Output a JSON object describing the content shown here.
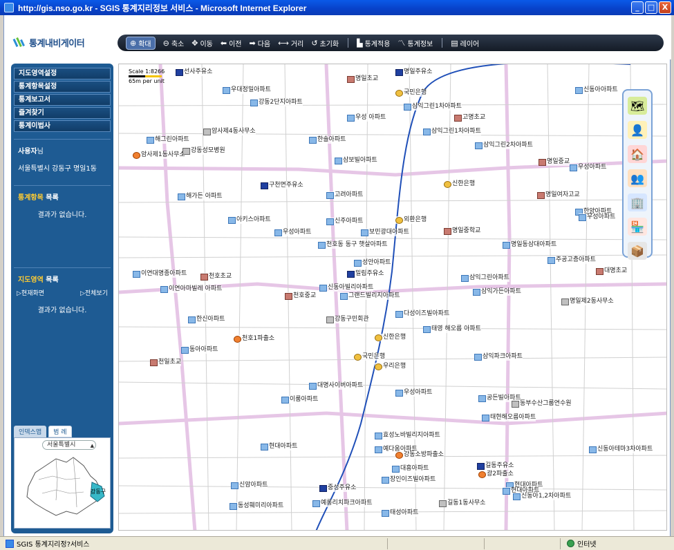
{
  "window": {
    "title": "http://gis.nso.go.kr - SGIS 통계지리정보 서비스 - Microsoft Internet Explorer",
    "buttons": [
      "_",
      "□",
      "X"
    ]
  },
  "header": {
    "logo_text": "통계내비게이터",
    "toolbar": [
      {
        "id": "zoom-in",
        "icon": "zoom-in-icon",
        "glyph": "⊕",
        "label": "확대",
        "active": true
      },
      {
        "id": "zoom-out",
        "icon": "zoom-out-icon",
        "glyph": "⊖",
        "label": "축소"
      },
      {
        "id": "pan",
        "icon": "move-icon",
        "glyph": "✥",
        "label": "이동"
      },
      {
        "id": "prev",
        "icon": "arrow-left-icon",
        "glyph": "⬅",
        "label": "이전"
      },
      {
        "id": "next",
        "icon": "arrow-right-icon",
        "glyph": "➡",
        "label": "다음"
      },
      {
        "id": "distance",
        "icon": "ruler-icon",
        "glyph": "⟷",
        "label": "거리"
      },
      {
        "id": "reset",
        "icon": "reset-icon",
        "glyph": "↺",
        "label": "초기화"
      },
      {
        "id": "apply-stats",
        "icon": "bar-chart-icon",
        "glyph": "▙",
        "label": "통계적용"
      },
      {
        "id": "stats-info",
        "icon": "line-chart-icon",
        "glyph": "〽",
        "label": "통계정보"
      },
      {
        "id": "layer",
        "icon": "layer-icon",
        "glyph": "▤",
        "label": "레이어"
      }
    ]
  },
  "sidebar": {
    "menu": [
      "지도영역설정",
      "통계항목설정",
      "통계보고서",
      "즐겨찾기",
      "통계이법사"
    ],
    "user_label": "사용자",
    "user_suffix": "님",
    "address": "서울특별시 강동구 명일1동",
    "stat_items_title": "통계항목",
    "stat_items_suffix": " 목록",
    "no_result": "결과가 없습니다.",
    "region_title": "지도영역",
    "region_suffix": " 목록",
    "region_current": "▷현재화면",
    "region_all": "▷전체보기",
    "no_result_2": "결과가 없습니다.",
    "mini_tabs": [
      "인덱스맵",
      "범 례"
    ],
    "mini_select": "서울특별시",
    "mini_highlight": "강동구"
  },
  "map": {
    "scale_text": "Scale 1:8266",
    "scale_unit": "65m per unit",
    "labels": [
      {
        "t": "선사주유소",
        "c": "gas"
      },
      {
        "t": "명일초교",
        "c": "school"
      },
      {
        "t": "명일주유소",
        "c": "gas"
      },
      {
        "t": "우대정밀아파트",
        "c": ""
      },
      {
        "t": "강동2단지아파트",
        "c": ""
      },
      {
        "t": "국민은행",
        "c": "bank"
      },
      {
        "t": "삼익그린1차아파트",
        "c": ""
      },
      {
        "t": "신동아아파트",
        "c": ""
      },
      {
        "t": "우성 아파트",
        "c": ""
      },
      {
        "t": "고명초교",
        "c": "school"
      },
      {
        "t": "삼익그린1차아파트",
        "c": ""
      },
      {
        "t": "암사제4동사무소",
        "c": "gov"
      },
      {
        "t": "한솔아파트",
        "c": ""
      },
      {
        "t": "삼익그린2차아파트",
        "c": ""
      },
      {
        "t": "해그린아파트",
        "c": ""
      },
      {
        "t": "암사제1동사무소",
        "c": "fire"
      },
      {
        "t": "강동성모병원",
        "c": "gov"
      },
      {
        "t": "삼보빌아파트",
        "c": ""
      },
      {
        "t": "명일중교",
        "c": "school"
      },
      {
        "t": "우성아파트",
        "c": ""
      },
      {
        "t": "구천면주유소",
        "c": "gas"
      },
      {
        "t": "신한은행",
        "c": "bank"
      },
      {
        "t": "해가든 아파트",
        "c": ""
      },
      {
        "t": "고려아파트",
        "c": ""
      },
      {
        "t": "명일여자고교",
        "c": "school"
      },
      {
        "t": "한양아파트",
        "c": ""
      },
      {
        "t": "우성아파트",
        "c": ""
      },
      {
        "t": "아키스아파트",
        "c": ""
      },
      {
        "t": "신주아파트",
        "c": ""
      },
      {
        "t": "외환은행",
        "c": "bank"
      },
      {
        "t": "우성아파트",
        "c": ""
      },
      {
        "t": "보민광대아파트",
        "c": ""
      },
      {
        "t": "명일중학교",
        "c": "school"
      },
      {
        "t": "명일동삼대아파트",
        "c": ""
      },
      {
        "t": "천호동 동구 햇살아파트",
        "c": ""
      },
      {
        "t": "주공고층아파트",
        "c": ""
      },
      {
        "t": "성안아파트",
        "c": ""
      },
      {
        "t": "대명초교",
        "c": "school"
      },
      {
        "t": "이연대명종아파트",
        "c": ""
      },
      {
        "t": "천호초교",
        "c": "school"
      },
      {
        "t": "밀림주유소",
        "c": "gas"
      },
      {
        "t": "삼익그린아파트",
        "c": ""
      },
      {
        "t": "신동아빌리아파트",
        "c": ""
      },
      {
        "t": "이연아마빌레 아파트",
        "c": ""
      },
      {
        "t": "천호중교",
        "c": "school"
      },
      {
        "t": "그랜드빌리지아파트",
        "c": ""
      },
      {
        "t": "삼익가든아파트",
        "c": ""
      },
      {
        "t": "명일제2동사무소",
        "c": "gov"
      },
      {
        "t": "다성이즈빌아파트",
        "c": ""
      },
      {
        "t": "한신아파트",
        "c": ""
      },
      {
        "t": "강동구민회관",
        "c": "gov"
      },
      {
        "t": "태영 해오름 아파트",
        "c": ""
      },
      {
        "t": "천호1파출소",
        "c": "fire"
      },
      {
        "t": "신한은행",
        "c": "bank"
      },
      {
        "t": "동아아파트",
        "c": ""
      },
      {
        "t": "삼익파크아파트",
        "c": ""
      },
      {
        "t": "국민은행",
        "c": "bank"
      },
      {
        "t": "우리은행",
        "c": "bank"
      },
      {
        "t": "천일초교",
        "c": "school"
      },
      {
        "t": "대명사이버아파트",
        "c": ""
      },
      {
        "t": "우성아파트",
        "c": ""
      },
      {
        "t": "이룸아파트",
        "c": ""
      },
      {
        "t": "공든빌아파트",
        "c": ""
      },
      {
        "t": "동부수산그룹연수원",
        "c": "gov"
      },
      {
        "t": "태현해오름아파트",
        "c": ""
      },
      {
        "t": "현대아파트",
        "c": ""
      },
      {
        "t": "효성노바빌리지아파트",
        "c": ""
      },
      {
        "t": "신동아테마3차아파트",
        "c": ""
      },
      {
        "t": "예다움아파트",
        "c": ""
      },
      {
        "t": "강동소방파출소",
        "c": "fire"
      },
      {
        "t": "대흥아파트",
        "c": ""
      },
      {
        "t": "길동주유소",
        "c": "gas"
      },
      {
        "t": "신암아파트",
        "c": ""
      },
      {
        "t": "중성주유소",
        "c": "gas"
      },
      {
        "t": "장인이즈빌아파트",
        "c": ""
      },
      {
        "t": "광2파출소",
        "c": "fire"
      },
      {
        "t": "현대아파트",
        "c": ""
      },
      {
        "t": "현대아파트",
        "c": ""
      },
      {
        "t": "동성훼미리아파트",
        "c": ""
      },
      {
        "t": "예롱리치파크아파트",
        "c": ""
      },
      {
        "t": "태성아파트",
        "c": ""
      },
      {
        "t": "길동1동사무소",
        "c": "gov"
      },
      {
        "t": "신동아1,2차아파트",
        "c": ""
      }
    ],
    "layer_panel_icons": [
      "map-layer-icon",
      "person-icon",
      "house-icon",
      "people-icon",
      "building-icon",
      "shop-icon",
      "box-icon"
    ]
  },
  "statusbar": {
    "text": "SGIS 통계지리정?서비스",
    "zone": "인터넷"
  },
  "colors": {
    "sidebar_bg": "#1e5b93",
    "toolbar_bg": "#1f2936",
    "road_line": "#1f4fb8",
    "title_bar": "#0841c8"
  }
}
